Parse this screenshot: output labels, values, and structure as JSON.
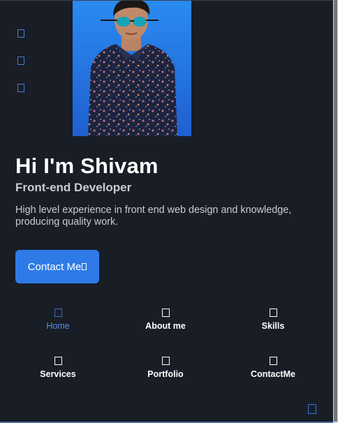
{
  "social": {
    "items": [
      {
        "icon": "linkedin-icon"
      },
      {
        "icon": "dribbble-icon"
      },
      {
        "icon": "github-icon"
      }
    ]
  },
  "hero": {
    "title": "Hi I'm Shivam",
    "subtitle": "Front-end Developer",
    "description": "High level experience in front end web design and knowledge, producing quality work.",
    "contact_button_label": "Contact Me",
    "contact_button_icon": "send-icon"
  },
  "nav": {
    "items": [
      {
        "label": "Home",
        "icon": "home-icon",
        "active": true
      },
      {
        "label": "About me",
        "icon": "user-icon",
        "active": false
      },
      {
        "label": "Skills",
        "icon": "file-icon",
        "active": false
      },
      {
        "label": "Services",
        "icon": "briefcase-icon",
        "active": false
      },
      {
        "label": "Portfolio",
        "icon": "image-icon",
        "active": false
      },
      {
        "label": "ContactMe",
        "icon": "message-icon",
        "active": false
      }
    ]
  },
  "colors": {
    "background": "#181d26",
    "accent": "#2e7be8",
    "text": "#ffffff",
    "muted_text": "#c9ccd3"
  },
  "scroll_up_icon": "arrow-up-icon"
}
